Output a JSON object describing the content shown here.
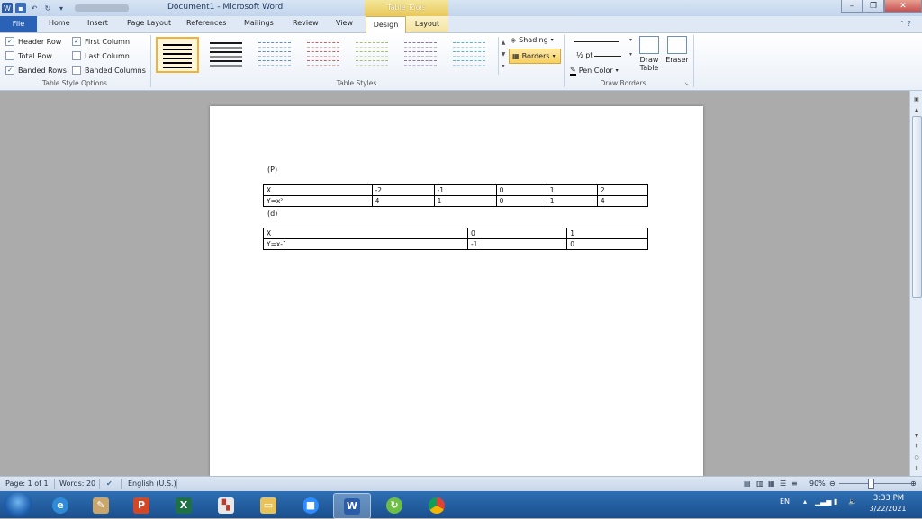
{
  "window": {
    "title": "Document1 - Microsoft Word",
    "contextual_tab_group": "Table Tools"
  },
  "tabs": [
    "File",
    "Home",
    "Insert",
    "Page Layout",
    "References",
    "Mailings",
    "Review",
    "View",
    "Design",
    "Layout"
  ],
  "ribbon": {
    "table_style_options": {
      "label": "Table Style Options",
      "options": [
        {
          "label": "Header Row",
          "checked": true
        },
        {
          "label": "First Column",
          "checked": true
        },
        {
          "label": "Total Row",
          "checked": false
        },
        {
          "label": "Last Column",
          "checked": false
        },
        {
          "label": "Banded Rows",
          "checked": true
        },
        {
          "label": "Banded Columns",
          "checked": false
        }
      ]
    },
    "table_styles": {
      "label": "Table Styles",
      "swatch_colors": [
        "#000000",
        "#000000",
        "#4F81BD",
        "#C0504D",
        "#9BBB59",
        "#8064A2",
        "#4BACC6"
      ]
    },
    "shading_label": "Shading",
    "borders_label": "Borders",
    "draw_borders": {
      "label": "Draw Borders",
      "line_weight": "½ pt",
      "pen_color_label": "Pen Color",
      "draw_table_label": "Draw Table",
      "eraser_label": "Eraser"
    }
  },
  "document": {
    "para1": "(P)",
    "table1": {
      "rows": [
        [
          "X",
          "-2",
          "-1",
          "0",
          "1",
          "2"
        ],
        [
          "Y=x²",
          "4",
          "1",
          "0",
          "1",
          "4"
        ]
      ]
    },
    "para2": "(d)",
    "table2": {
      "rows": [
        [
          "X",
          "0",
          "1"
        ],
        [
          "Y=x-1",
          "-1",
          "0"
        ]
      ]
    }
  },
  "status_bar": {
    "page": "Page: 1 of 1",
    "words": "Words: 20",
    "language": "English (U.S.)",
    "zoom": "90%"
  },
  "taskbar": {
    "language": "EN",
    "time": "3:33 PM",
    "date": "3/22/2021"
  },
  "colors": {
    "file_tab": "#2A62B8",
    "contextual_tab": "#F4E3A0",
    "taskbar": "#1A4F8E"
  }
}
